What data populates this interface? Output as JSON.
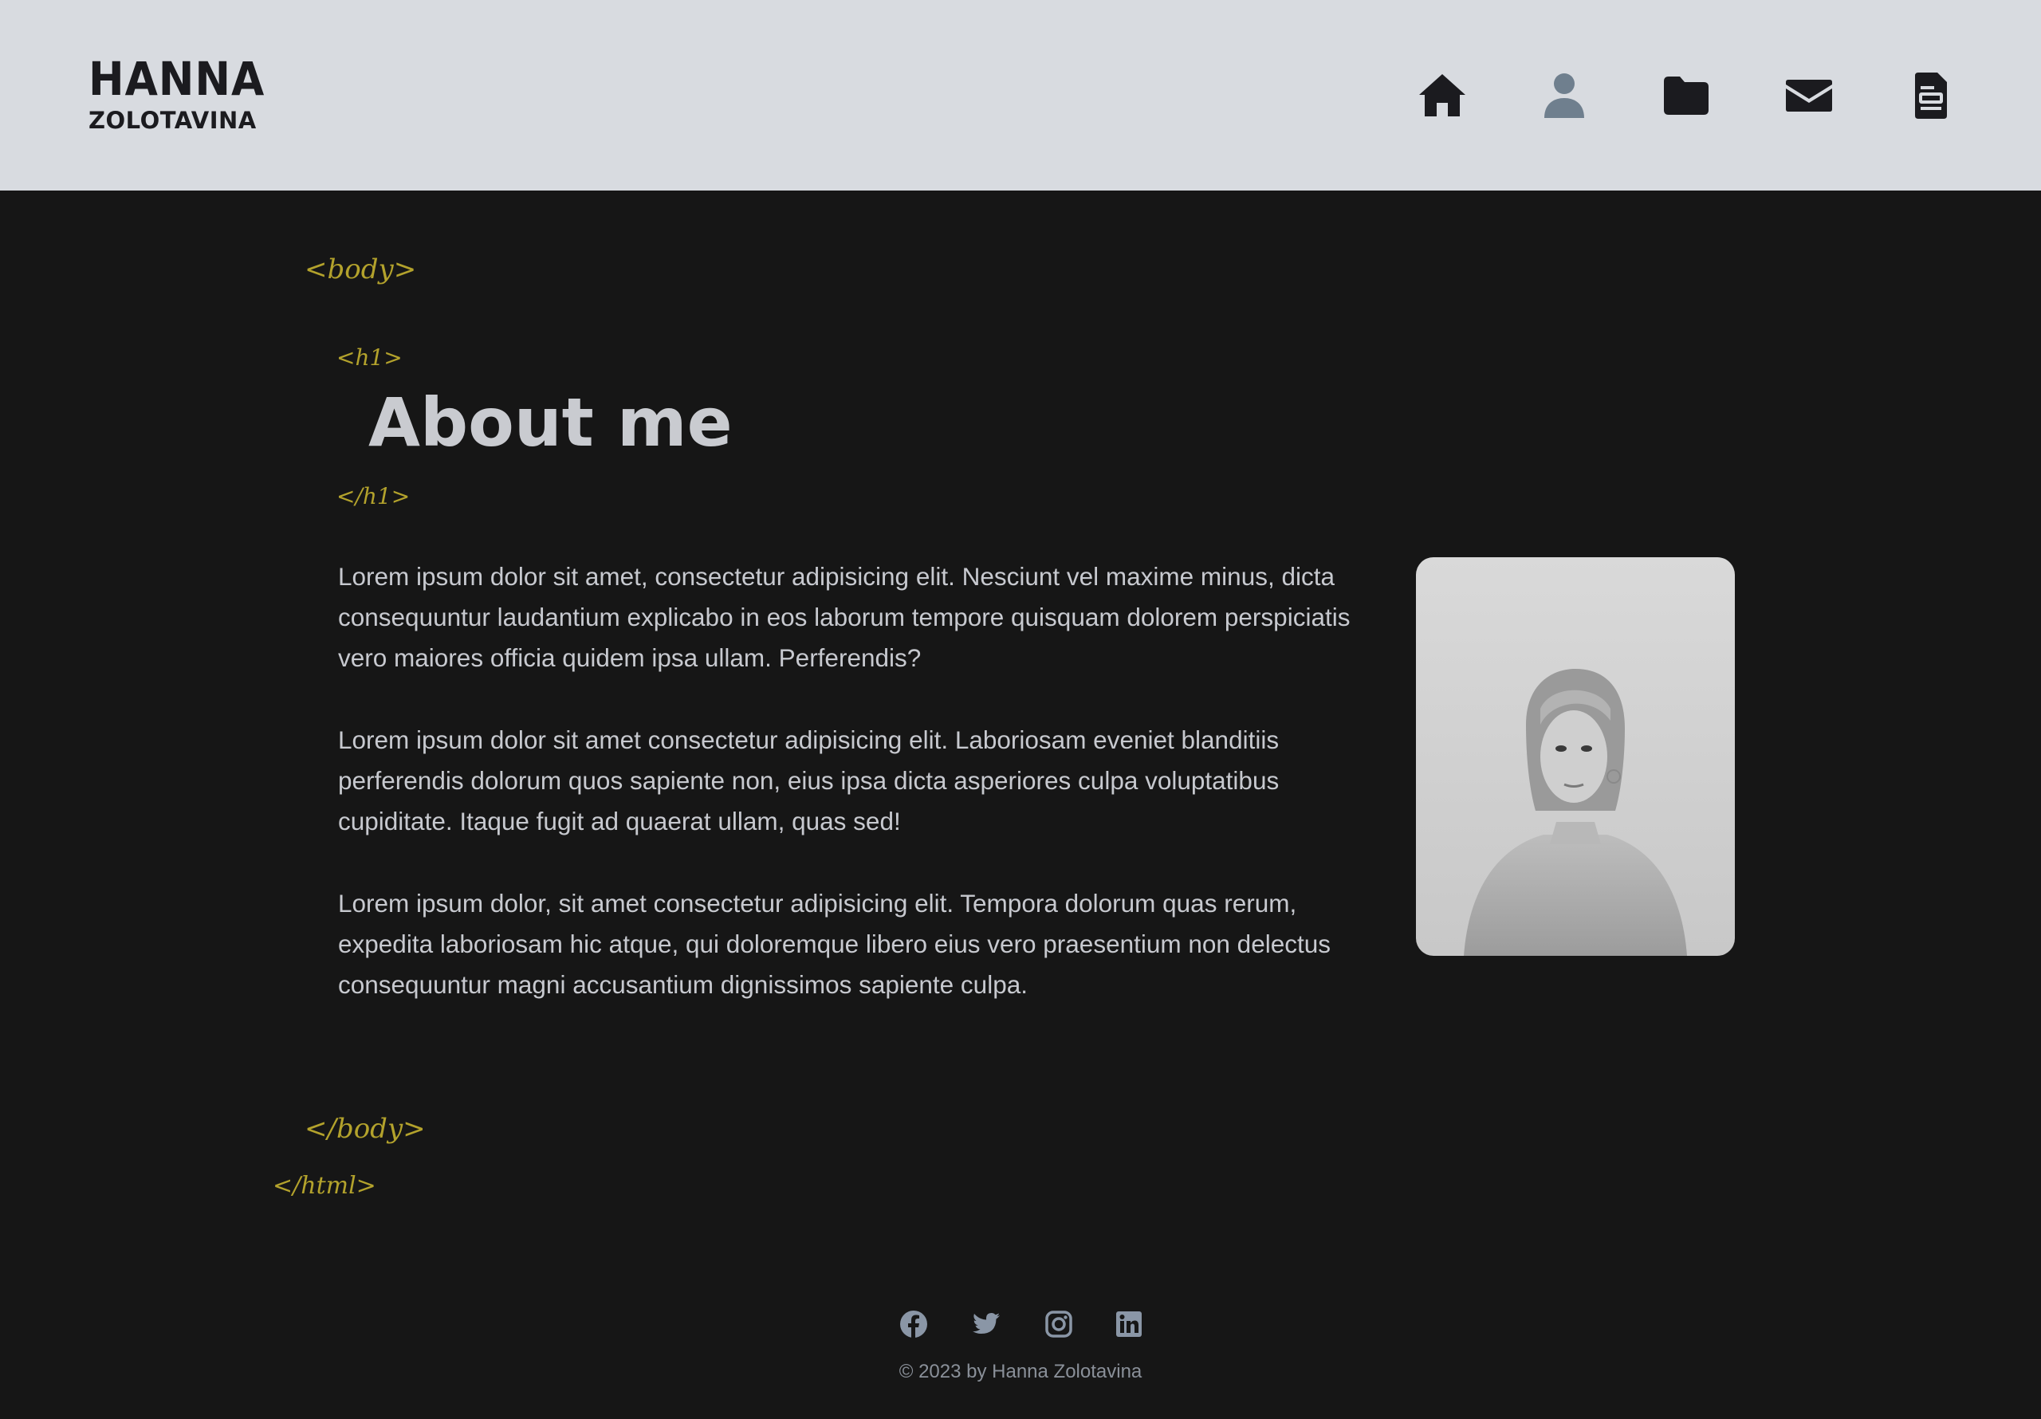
{
  "header": {
    "logo_first": "HANNA",
    "logo_last": "ZOLOTAVINA",
    "nav": [
      {
        "icon": "home-icon",
        "active": false
      },
      {
        "icon": "user-icon",
        "active": true
      },
      {
        "icon": "folder-icon",
        "active": false
      },
      {
        "icon": "envelope-icon",
        "active": false
      },
      {
        "icon": "document-icon",
        "active": false
      }
    ]
  },
  "tags": {
    "body_open": "<body>",
    "h1_open": "<h1>",
    "h1_close": "</h1>",
    "body_close": "</body>",
    "html_close": "</html>"
  },
  "main": {
    "title": "About me",
    "paragraphs": [
      "Lorem ipsum dolor sit amet, consectetur adipisicing elit. Nesciunt vel maxime minus, dicta consequuntur laudantium explicabo in eos laborum tempore quisquam dolorem perspiciatis vero maiores officia quidem ipsa ullam. Perferendis?",
      "Lorem ipsum dolor sit amet consectetur adipisicing elit. Laboriosam eveniet blanditiis perferendis dolorum quos sapiente non, eius ipsa dicta asperiores culpa voluptatibus cupiditate. Itaque fugit ad quaerat ullam, quas sed!",
      "Lorem ipsum dolor, sit amet consectetur adipisicing elit. Tempora dolorum quas rerum, expedita laboriosam hic atque, qui doloremque libero eius vero praesentium non delectus consequuntur magni accusantium dignissimos sapiente culpa."
    ]
  },
  "footer": {
    "socials": [
      "facebook-icon",
      "twitter-icon",
      "instagram-icon",
      "linkedin-icon"
    ],
    "copyright": "© 2023 by Hanna Zolotavina"
  },
  "colors": {
    "header_bg": "#d8dbe0",
    "page_bg": "#161616",
    "tag": "#b3a22c",
    "nav_active": "#6f7f8e",
    "nav_icon": "#1b1b1f",
    "text": "#c7c9cf",
    "footer_icon": "#8a96a6"
  }
}
